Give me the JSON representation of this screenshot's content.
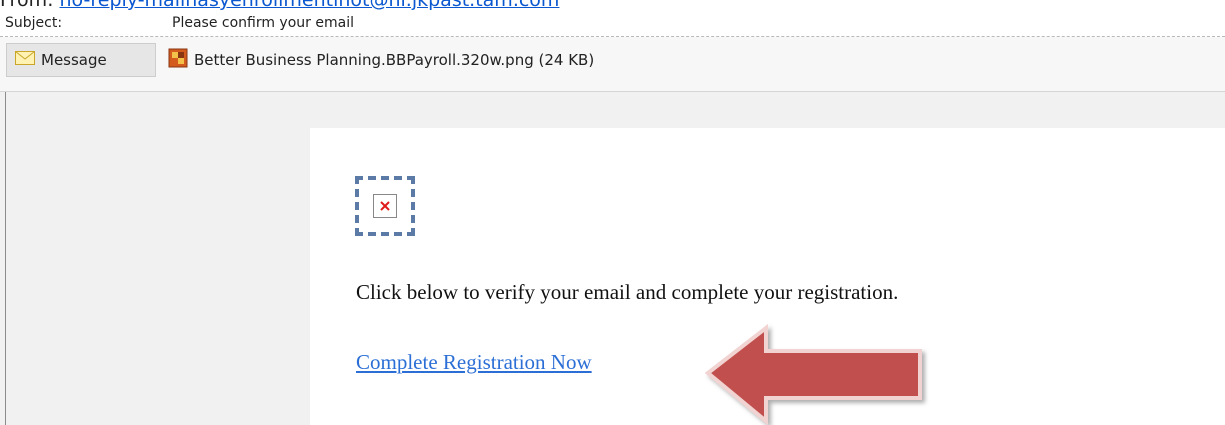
{
  "header": {
    "from_label": "From:",
    "from_value": "no-reply-mailnasyehrollmentinot@ni.jkpast.tam.com",
    "subject_label": "Subject:",
    "subject_value": "Please confirm your email"
  },
  "attachments": {
    "message_tab_label": "Message",
    "file_label": "Better Business Planning.BBPayroll.320w.png (24 KB)"
  },
  "email": {
    "body_text": "Click below to verify your email and complete your registration.",
    "link_text": "Complete Registration Now"
  },
  "colors": {
    "link": "#2b6fd6",
    "arrow": "#c0504d",
    "selection_dash": "#5b7aa5"
  },
  "icons": {
    "message_tab": "envelope-icon",
    "attachment": "png-file-icon",
    "broken_image": "broken-image-icon",
    "pointer": "red-arrow-graphic"
  }
}
